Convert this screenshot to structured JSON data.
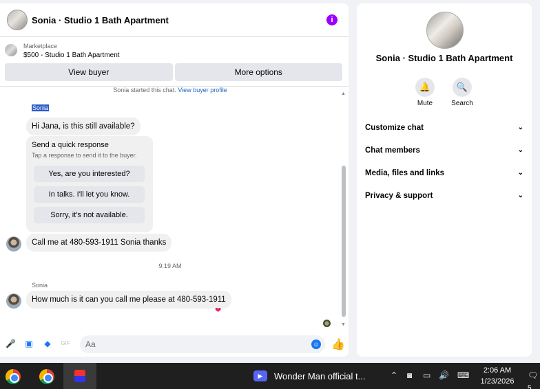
{
  "header": {
    "title": "Sonia · Studio 1 Bath Apartment",
    "info_icon": "i"
  },
  "marketplace": {
    "label": "Marketplace",
    "listing": "$500 - Studio 1 Bath Apartment"
  },
  "actions": {
    "view_buyer": "View buyer",
    "more_options": "More options"
  },
  "thread": {
    "started_text": "Sonia started this chat.",
    "view_profile_link": "View buyer profile",
    "sender_first": "Sonia",
    "msg1": "Hi Jana, is this still available?",
    "quick_title": "Send a quick response",
    "quick_subtitle": "Tap a response to send it to the buyer.",
    "quick_options": [
      "Yes, are you interested?",
      "In talks. I'll let you know.",
      "Sorry, it's not available."
    ],
    "msg2": "Call me at 480-593-1911 Sonia  thanks",
    "time": "9:19 AM",
    "sender_second": "Sonia",
    "msg3": "How much  is it can you call me please at 480-593-1911",
    "reaction": "❤"
  },
  "composer": {
    "placeholder": "Aa"
  },
  "panel": {
    "title": "Sonia · Studio 1 Bath Apartment",
    "mute": "Mute",
    "search": "Search",
    "rows": [
      "Customize chat",
      "Chat members",
      "Media, files and links",
      "Privacy & support"
    ]
  },
  "taskbar": {
    "media_title": "Wonder Man official t...",
    "time": "2:06 AM",
    "date": "1/23/2026",
    "notif_count": "5"
  },
  "colors": {
    "accent": "#1877f2",
    "info": "#9b00ff",
    "bubble": "#f0f0f0",
    "taskbar": "#1f1f1f"
  }
}
